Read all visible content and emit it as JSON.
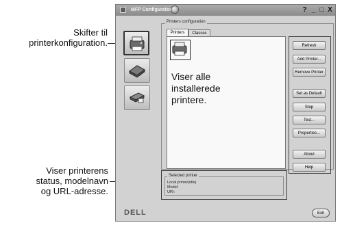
{
  "callouts": {
    "top_line1": "Skifter til",
    "top_line2": "printerkonfiguration.",
    "bottom_line1": "Viser printerens",
    "bottom_line2": "status, modelnavn",
    "bottom_line3": "og URL-adresse.",
    "overlay_line1": "Viser alle",
    "overlay_line2": "installerede",
    "overlay_line3": "printere."
  },
  "window": {
    "title": "MFP Configurator",
    "minimize": "_",
    "maximize": "□",
    "close": "X",
    "help": "?"
  },
  "sidebar": {
    "items": [
      {
        "icon": "printer-icon"
      },
      {
        "icon": "scanner-icon"
      },
      {
        "icon": "ports-icon"
      }
    ]
  },
  "printers_config": {
    "group_label": "Printers configuration",
    "tabs": [
      {
        "label": "Printers"
      },
      {
        "label": "Classes"
      }
    ],
    "buttons": [
      {
        "label": "Refresh"
      },
      {
        "label": "Add Printer..."
      },
      {
        "label": "Remove Printer"
      },
      {
        "label": "Set as Default"
      },
      {
        "label": "Stop"
      },
      {
        "label": "Test..."
      },
      {
        "label": "Properties..."
      },
      {
        "label": "About"
      },
      {
        "label": "Help"
      }
    ]
  },
  "selected_printer": {
    "label": "Selected printer",
    "local": "Local printer(idle)",
    "model": "Model:",
    "uri": "URI:"
  },
  "footer": {
    "logo": "DELL",
    "exit": "Exit"
  }
}
